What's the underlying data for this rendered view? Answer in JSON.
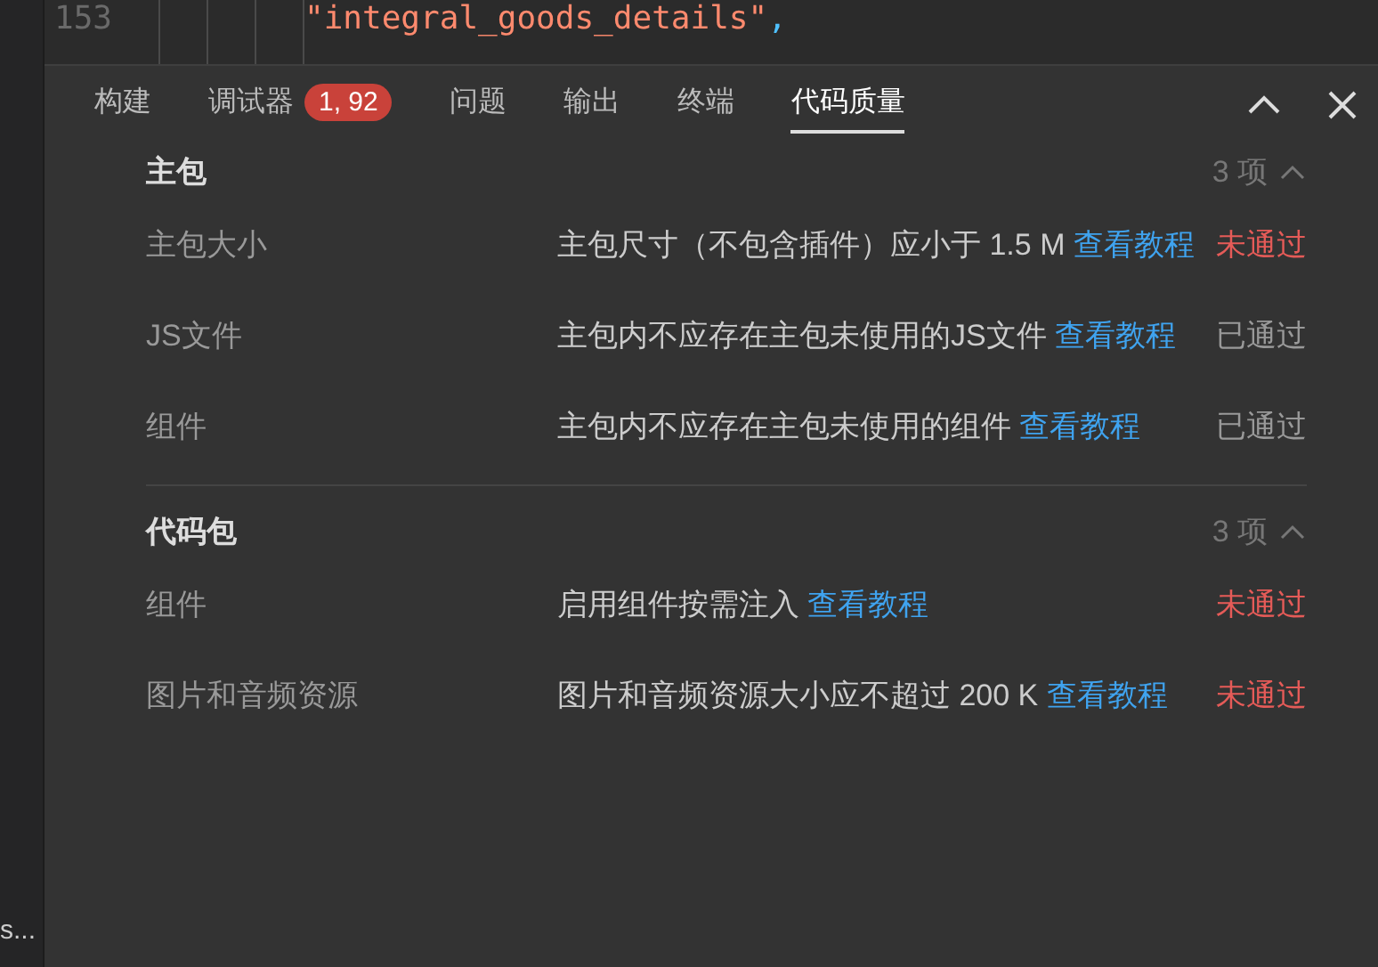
{
  "sidebar": {
    "truncated_label": "s..."
  },
  "editor": {
    "line_number": "153",
    "string": "\"integral_goods_details\"",
    "punct": ","
  },
  "tabs": [
    {
      "label": "构建",
      "selected": false
    },
    {
      "label": "调试器",
      "selected": false,
      "badge": "1, 92"
    },
    {
      "label": "问题",
      "selected": false
    },
    {
      "label": "输出",
      "selected": false
    },
    {
      "label": "终端",
      "selected": false
    },
    {
      "label": "代码质量",
      "selected": true
    }
  ],
  "sections": [
    {
      "title": "主包",
      "count": "3 项",
      "expanded": true,
      "rows": [
        {
          "name": "主包大小",
          "description": "主包尺寸（不包含插件）应小于 1.5 M",
          "link": "查看教程",
          "status": "未通过",
          "passed": false
        },
        {
          "name": "JS文件",
          "description": "主包内不应存在主包未使用的JS文件",
          "link": "查看教程",
          "status": "已通过",
          "passed": true
        },
        {
          "name": "组件",
          "description": "主包内不应存在主包未使用的组件",
          "link": "查看教程",
          "status": "已通过",
          "passed": true
        }
      ]
    },
    {
      "title": "代码包",
      "count": "3 项",
      "expanded": true,
      "rows": [
        {
          "name": "组件",
          "description": "启用组件按需注入",
          "link": "查看教程",
          "status": "未通过",
          "passed": false
        },
        {
          "name": "图片和音频资源",
          "description": "图片和音频资源大小应不超过 200 K",
          "link": "查看教程",
          "status": "未通过",
          "passed": false
        }
      ]
    }
  ]
}
